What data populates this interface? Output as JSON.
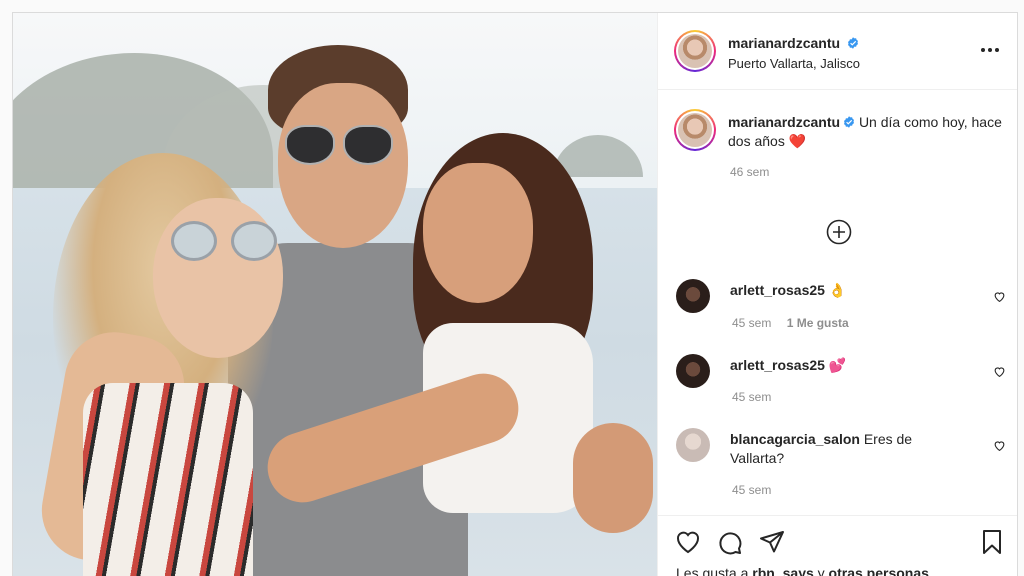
{
  "post": {
    "author": "marianardzcantu",
    "location": "Puerto Vallarta, Jalisco",
    "caption_text": "Un día como hoy, hace dos años",
    "caption_emoji": "❤️",
    "caption_time": "46 sem"
  },
  "comments": [
    {
      "user": "arlett_rosas25",
      "text": "👌",
      "time": "45 sem",
      "likes": "1 Me gusta"
    },
    {
      "user": "arlett_rosas25",
      "text": "💕",
      "time": "45 sem",
      "likes": ""
    },
    {
      "user": "blancagarcia_salon",
      "text": "Eres de Vallarta?",
      "time": "45 sem",
      "likes": ""
    }
  ],
  "likes_summary": {
    "prefix": "Les gusta a",
    "user": "rbn_says",
    "connector": "y",
    "rest": "otras personas"
  },
  "colors": {
    "verified": "#3897f0",
    "text": "#262626",
    "muted": "#8e8e8e",
    "border": "#dbdbdb"
  },
  "icons": [
    "verified-badge-icon",
    "more-options-icon",
    "add-circle-icon",
    "heart-icon",
    "comment-icon",
    "share-icon",
    "bookmark-icon"
  ]
}
